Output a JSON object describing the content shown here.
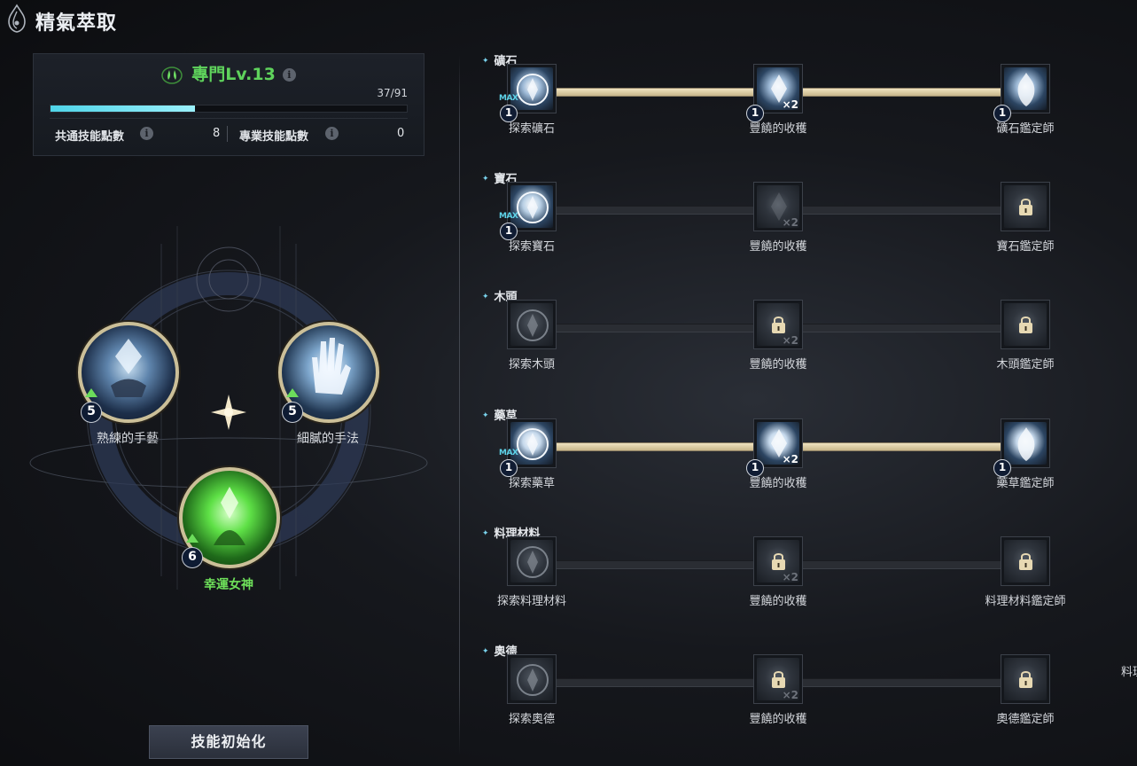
{
  "window": {
    "title": "精氣萃取"
  },
  "level_panel": {
    "title": "專門Lv.13",
    "xp_text": "37/91",
    "xp_fraction": 0.4066,
    "common_points_label": "共通技能點數",
    "common_points_value": "8",
    "pro_points_label": "專業技能點數",
    "pro_points_value": "0"
  },
  "skills": [
    {
      "name": "熟練的手藝",
      "level": "5"
    },
    {
      "name": "細膩的手法",
      "level": "5"
    },
    {
      "name": "幸運女神",
      "level": "6"
    }
  ],
  "reset_button": "技能初始化",
  "tree": [
    {
      "title": "礦石",
      "nodes": [
        {
          "label": "探索礦石",
          "level": "1",
          "max": "MAX",
          "unlocked": true
        },
        {
          "label": "豐饒的收穫",
          "level": "1",
          "mult": "×2",
          "unlocked": true
        },
        {
          "label": "礦石鑑定師",
          "level": "1",
          "unlocked": true
        }
      ],
      "active": true
    },
    {
      "title": "寶石",
      "nodes": [
        {
          "label": "探索寶石",
          "level": "1",
          "max": "MAX",
          "unlocked": true
        },
        {
          "label": "豐饒的收穫",
          "mult": "×2",
          "unlocked": false,
          "locked_icon": false
        },
        {
          "label": "寶石鑑定師",
          "unlocked": false,
          "locked_icon": true
        }
      ],
      "active": false
    },
    {
      "title": "木頭",
      "nodes": [
        {
          "label": "探索木頭",
          "unlocked": false
        },
        {
          "label": "豐饒的收穫",
          "mult": "×2",
          "unlocked": false,
          "locked_icon": true
        },
        {
          "label": "木頭鑑定師",
          "unlocked": false,
          "locked_icon": true
        }
      ],
      "active": false
    },
    {
      "title": "藥草",
      "nodes": [
        {
          "label": "探索藥草",
          "level": "1",
          "max": "MAX",
          "unlocked": true
        },
        {
          "label": "豐饒的收穫",
          "level": "1",
          "mult": "×2",
          "unlocked": true
        },
        {
          "label": "藥草鑑定師",
          "level": "1",
          "unlocked": true
        }
      ],
      "active": true
    },
    {
      "title": "料理材料",
      "nodes": [
        {
          "label": "探索料理材料",
          "unlocked": false
        },
        {
          "label": "豐饒的收穫",
          "mult": "×2",
          "unlocked": false,
          "locked_icon": true
        },
        {
          "label": "料理材料鑑定師",
          "unlocked": false,
          "locked_icon": true
        }
      ],
      "active": false
    },
    {
      "title": "奧德",
      "nodes": [
        {
          "label": "探索奧德",
          "unlocked": false
        },
        {
          "label": "豐饒的收穫",
          "mult": "×2",
          "unlocked": false,
          "locked_icon": true
        },
        {
          "label": "奧德鑑定師",
          "unlocked": false,
          "locked_icon": true
        }
      ],
      "active": false
    }
  ],
  "edge_text": "料理",
  "colors": {
    "accent_green": "#5fd35c",
    "xp_cyan": "#4fd4e8",
    "track_gold": "#efe3c0"
  }
}
